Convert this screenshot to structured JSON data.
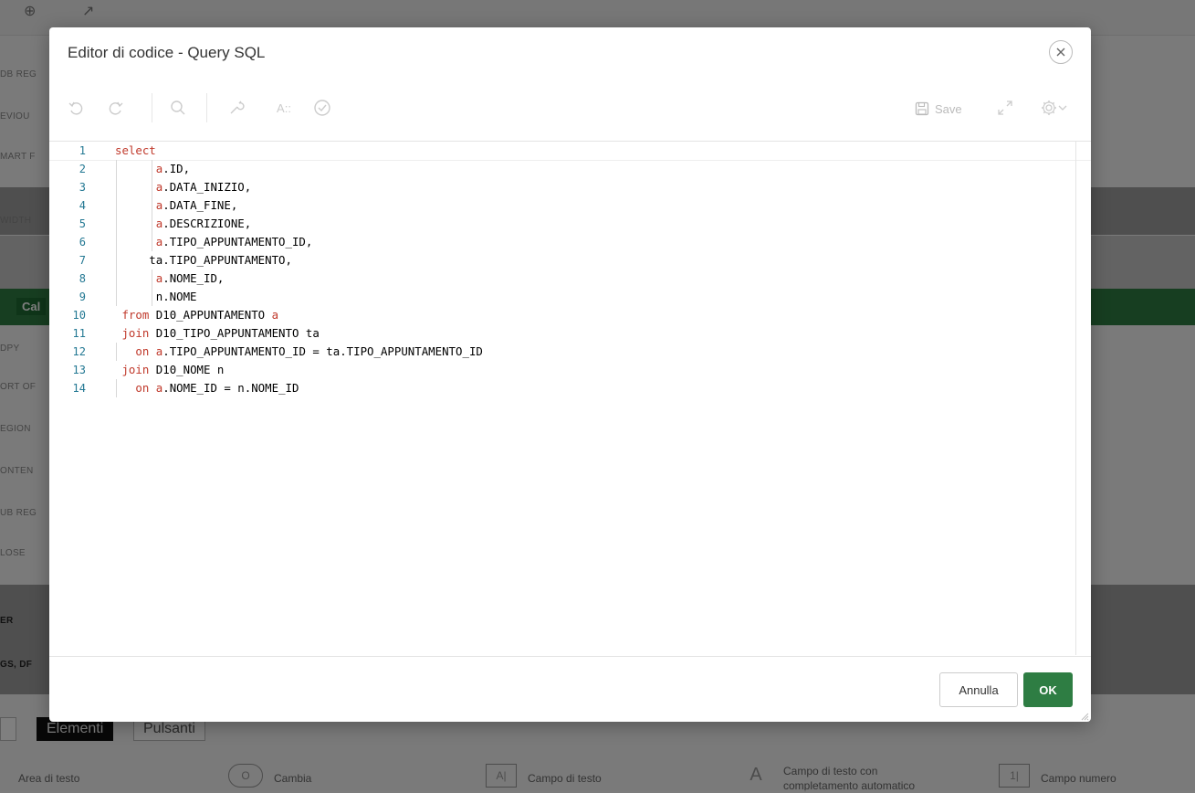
{
  "background": {
    "left_labels": [
      "DB REG",
      "EVIOU",
      "MART F",
      "WIDTH",
      "DPY",
      "ORT OF",
      "EGION",
      "ONTEN",
      "UB REG",
      "LOSE",
      "ER",
      "GS, DF"
    ],
    "green_bar_label": "Cal",
    "tabs": [
      "Elementi",
      "Pulsanti"
    ],
    "items": [
      {
        "label": "Area di testo"
      },
      {
        "label": "Cambia",
        "icon_text": "O"
      },
      {
        "label": "Campo di testo",
        "icon_text": "A|"
      },
      {
        "label": "Campo di testo con completamento automatico",
        "icon_text": "A"
      },
      {
        "label": "Campo numero",
        "icon_text": "1|"
      }
    ]
  },
  "dialog": {
    "title": "Editor di codice - Query SQL",
    "toolbar": {
      "undo_icon": "undo-icon",
      "redo_icon": "redo-icon",
      "search_icon": "search-icon",
      "wrench_icon": "wrench-icon",
      "format_label": "A::",
      "validate_icon": "check-circle-icon",
      "save_label": "Save",
      "expand_icon": "expand-icon",
      "settings_icon": "gear-icon"
    },
    "editor": {
      "line_numbers": [
        "1",
        "2",
        "3",
        "4",
        "5",
        "6",
        "7",
        "8",
        "9",
        "10",
        "11",
        "12",
        "13",
        "14"
      ],
      "lines": [
        "select",
        "      a.ID,",
        "      a.DATA_INIZIO,",
        "      a.DATA_FINE,",
        "      a.DESCRIZIONE,",
        "      a.TIPO_APPUNTAMENTO_ID,",
        "     ta.TIPO_APPUNTAMENTO,",
        "      a.NOME_ID,",
        "      n.NOME",
        " from D10_APPUNTAMENTO a",
        " join D10_TIPO_APPUNTAMENTO ta",
        "   on a.TIPO_APPUNTAMENTO_ID = ta.TIPO_APPUNTAMENTO_ID",
        " join D10_NOME n",
        "   on a.NOME_ID = n.NOME_ID"
      ]
    },
    "footer": {
      "cancel_label": "Annulla",
      "ok_label": "OK"
    }
  },
  "colors": {
    "keyword": "#c0392b",
    "line_number": "#237893",
    "ok_button": "#2e7d43"
  }
}
